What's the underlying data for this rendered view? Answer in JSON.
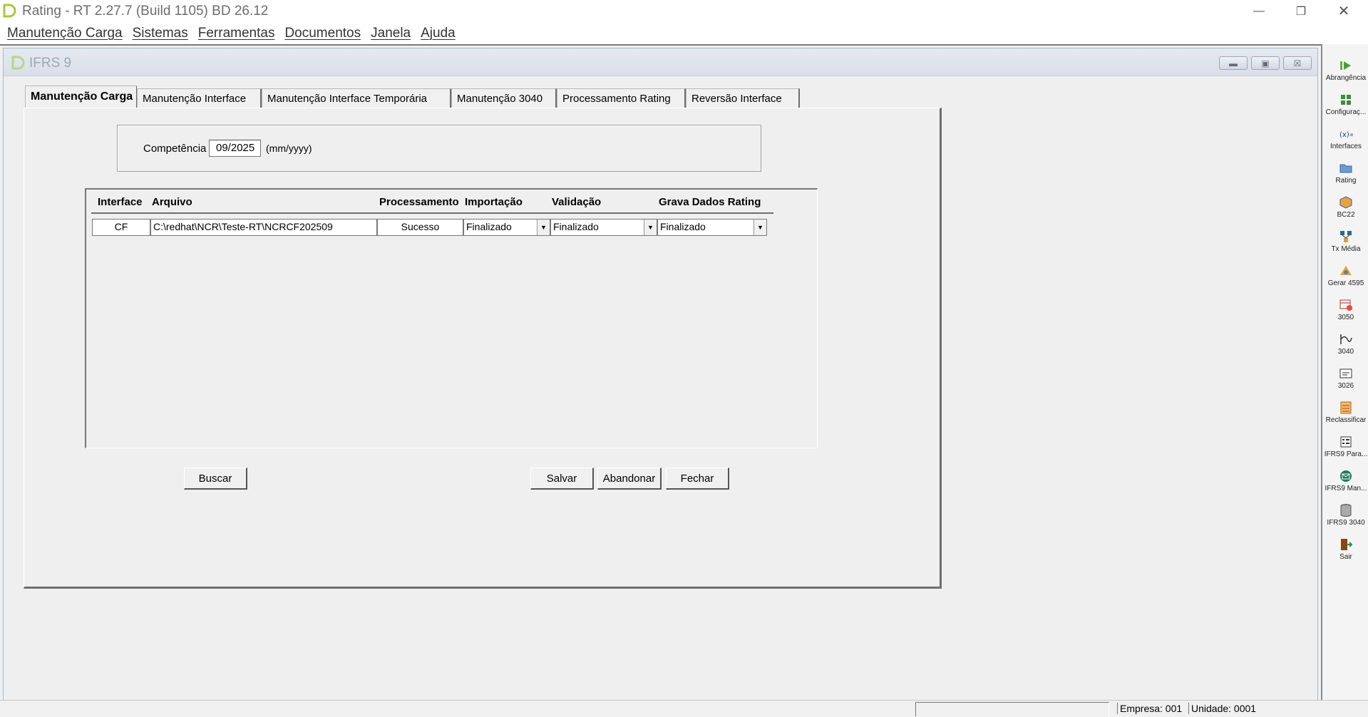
{
  "window": {
    "title": "Rating - RT 2.27.7 (Build 1105) BD 26.12"
  },
  "menu": [
    "Manutenção Carga",
    "Sistemas",
    "Ferramentas",
    "Documentos",
    "Janela",
    "Ajuda"
  ],
  "child": {
    "title": "IFRS 9"
  },
  "tabs": [
    "Manutenção Carga",
    "Manutenção Interface",
    "Manutenção Interface Temporária",
    "Manutenção 3040",
    "Processamento Rating",
    "Reversão Interface"
  ],
  "form": {
    "competencia_label": "Competência",
    "competencia_value": "09/2025",
    "competencia_hint": "(mm/yyyy)"
  },
  "grid": {
    "headers": [
      "Interface",
      "Arquivo",
      "Processamento",
      "Importação",
      "Validação",
      "Grava Dados Rating"
    ],
    "rows": [
      {
        "interface": "CF",
        "arquivo": "C:\\redhat\\NCR\\Teste-RT\\NCRCF202509",
        "processamento": "Sucesso",
        "importacao": "Finalizado",
        "validacao": "Finalizado",
        "grava": "Finalizado"
      }
    ]
  },
  "buttons": {
    "buscar": "Buscar",
    "salvar": "Salvar",
    "abandonar": "Abandonar",
    "fechar": "Fechar"
  },
  "toolbar": [
    {
      "label": "Abrangência",
      "icon": "play-chart-icon"
    },
    {
      "label": "Configuraç...",
      "icon": "config-grid-icon"
    },
    {
      "label": "Interfaces",
      "icon": "interface-icon"
    },
    {
      "label": "Rating",
      "icon": "folder-icon"
    },
    {
      "label": "BC22",
      "icon": "cube-icon"
    },
    {
      "label": "Tx Média",
      "icon": "hierarchy-icon"
    },
    {
      "label": "Gerar 4595",
      "icon": "triangle-icon"
    },
    {
      "label": "3050",
      "icon": "table-red-icon"
    },
    {
      "label": "3040",
      "icon": "curve-icon"
    },
    {
      "label": "3026",
      "icon": "window-icon"
    },
    {
      "label": "Reclassificar",
      "icon": "list-icon"
    },
    {
      "label": "IFRS9 Para...",
      "icon": "params-icon"
    },
    {
      "label": "IFRS9 Man...",
      "icon": "email-icon"
    },
    {
      "label": "IFRS9 3040",
      "icon": "database-icon"
    },
    {
      "label": "Sair",
      "icon": "exit-door-icon"
    }
  ],
  "status": {
    "empresa": "Empresa: 001",
    "unidade": "Unidade: 0001"
  }
}
